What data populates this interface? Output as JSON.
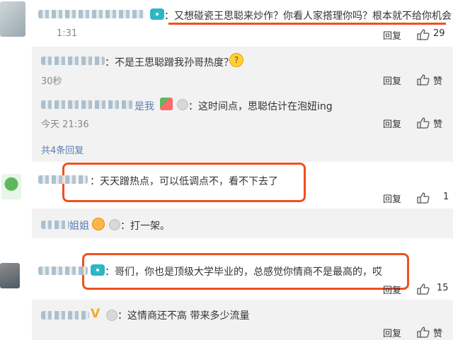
{
  "comments": [
    {
      "text": "：又想碰瓷王思聪来炒作？你看人家搭理你吗？根本就不给你机会",
      "time": "1:31",
      "reply_label": "回复",
      "like_count": "29",
      "highlighted": true
    },
    {
      "text": "：天天蹭热点，可以低调点不，看不下去了",
      "reply_label": "回复",
      "like_count": "1",
      "highlighted": true
    },
    {
      "text": "：哥们，你也是顶级大学毕业的，总感觉你情商不是最高的，哎",
      "reply_label": "回复",
      "like_count": "15",
      "highlighted": true
    }
  ],
  "replies": [
    {
      "text": "：不是王思聪蹭我孙哥热度？",
      "time": "30秒",
      "reply_label": "回复",
      "like_count": "赞"
    },
    {
      "name_suffix": "是我",
      "text": "：这时间点，思聪估计在泡妞ing",
      "time": "今天 21:36",
      "reply_label": "回复",
      "like_count": "赞"
    },
    {
      "name_suffix": "姐姐",
      "text": "：打一架。"
    },
    {
      "text": "：这情商还不高 带来多少流量",
      "reply_label": "回复",
      "like_count": "赞"
    }
  ],
  "more_replies": "共4条回复",
  "colors": {
    "highlight": "#f0501e",
    "link": "#5b7fae",
    "sub_bg": "#f2f2f2"
  },
  "icons": [
    "thumbs-up-icon",
    "camera-badge-icon",
    "vip-medal-icon",
    "emoji-icon"
  ]
}
